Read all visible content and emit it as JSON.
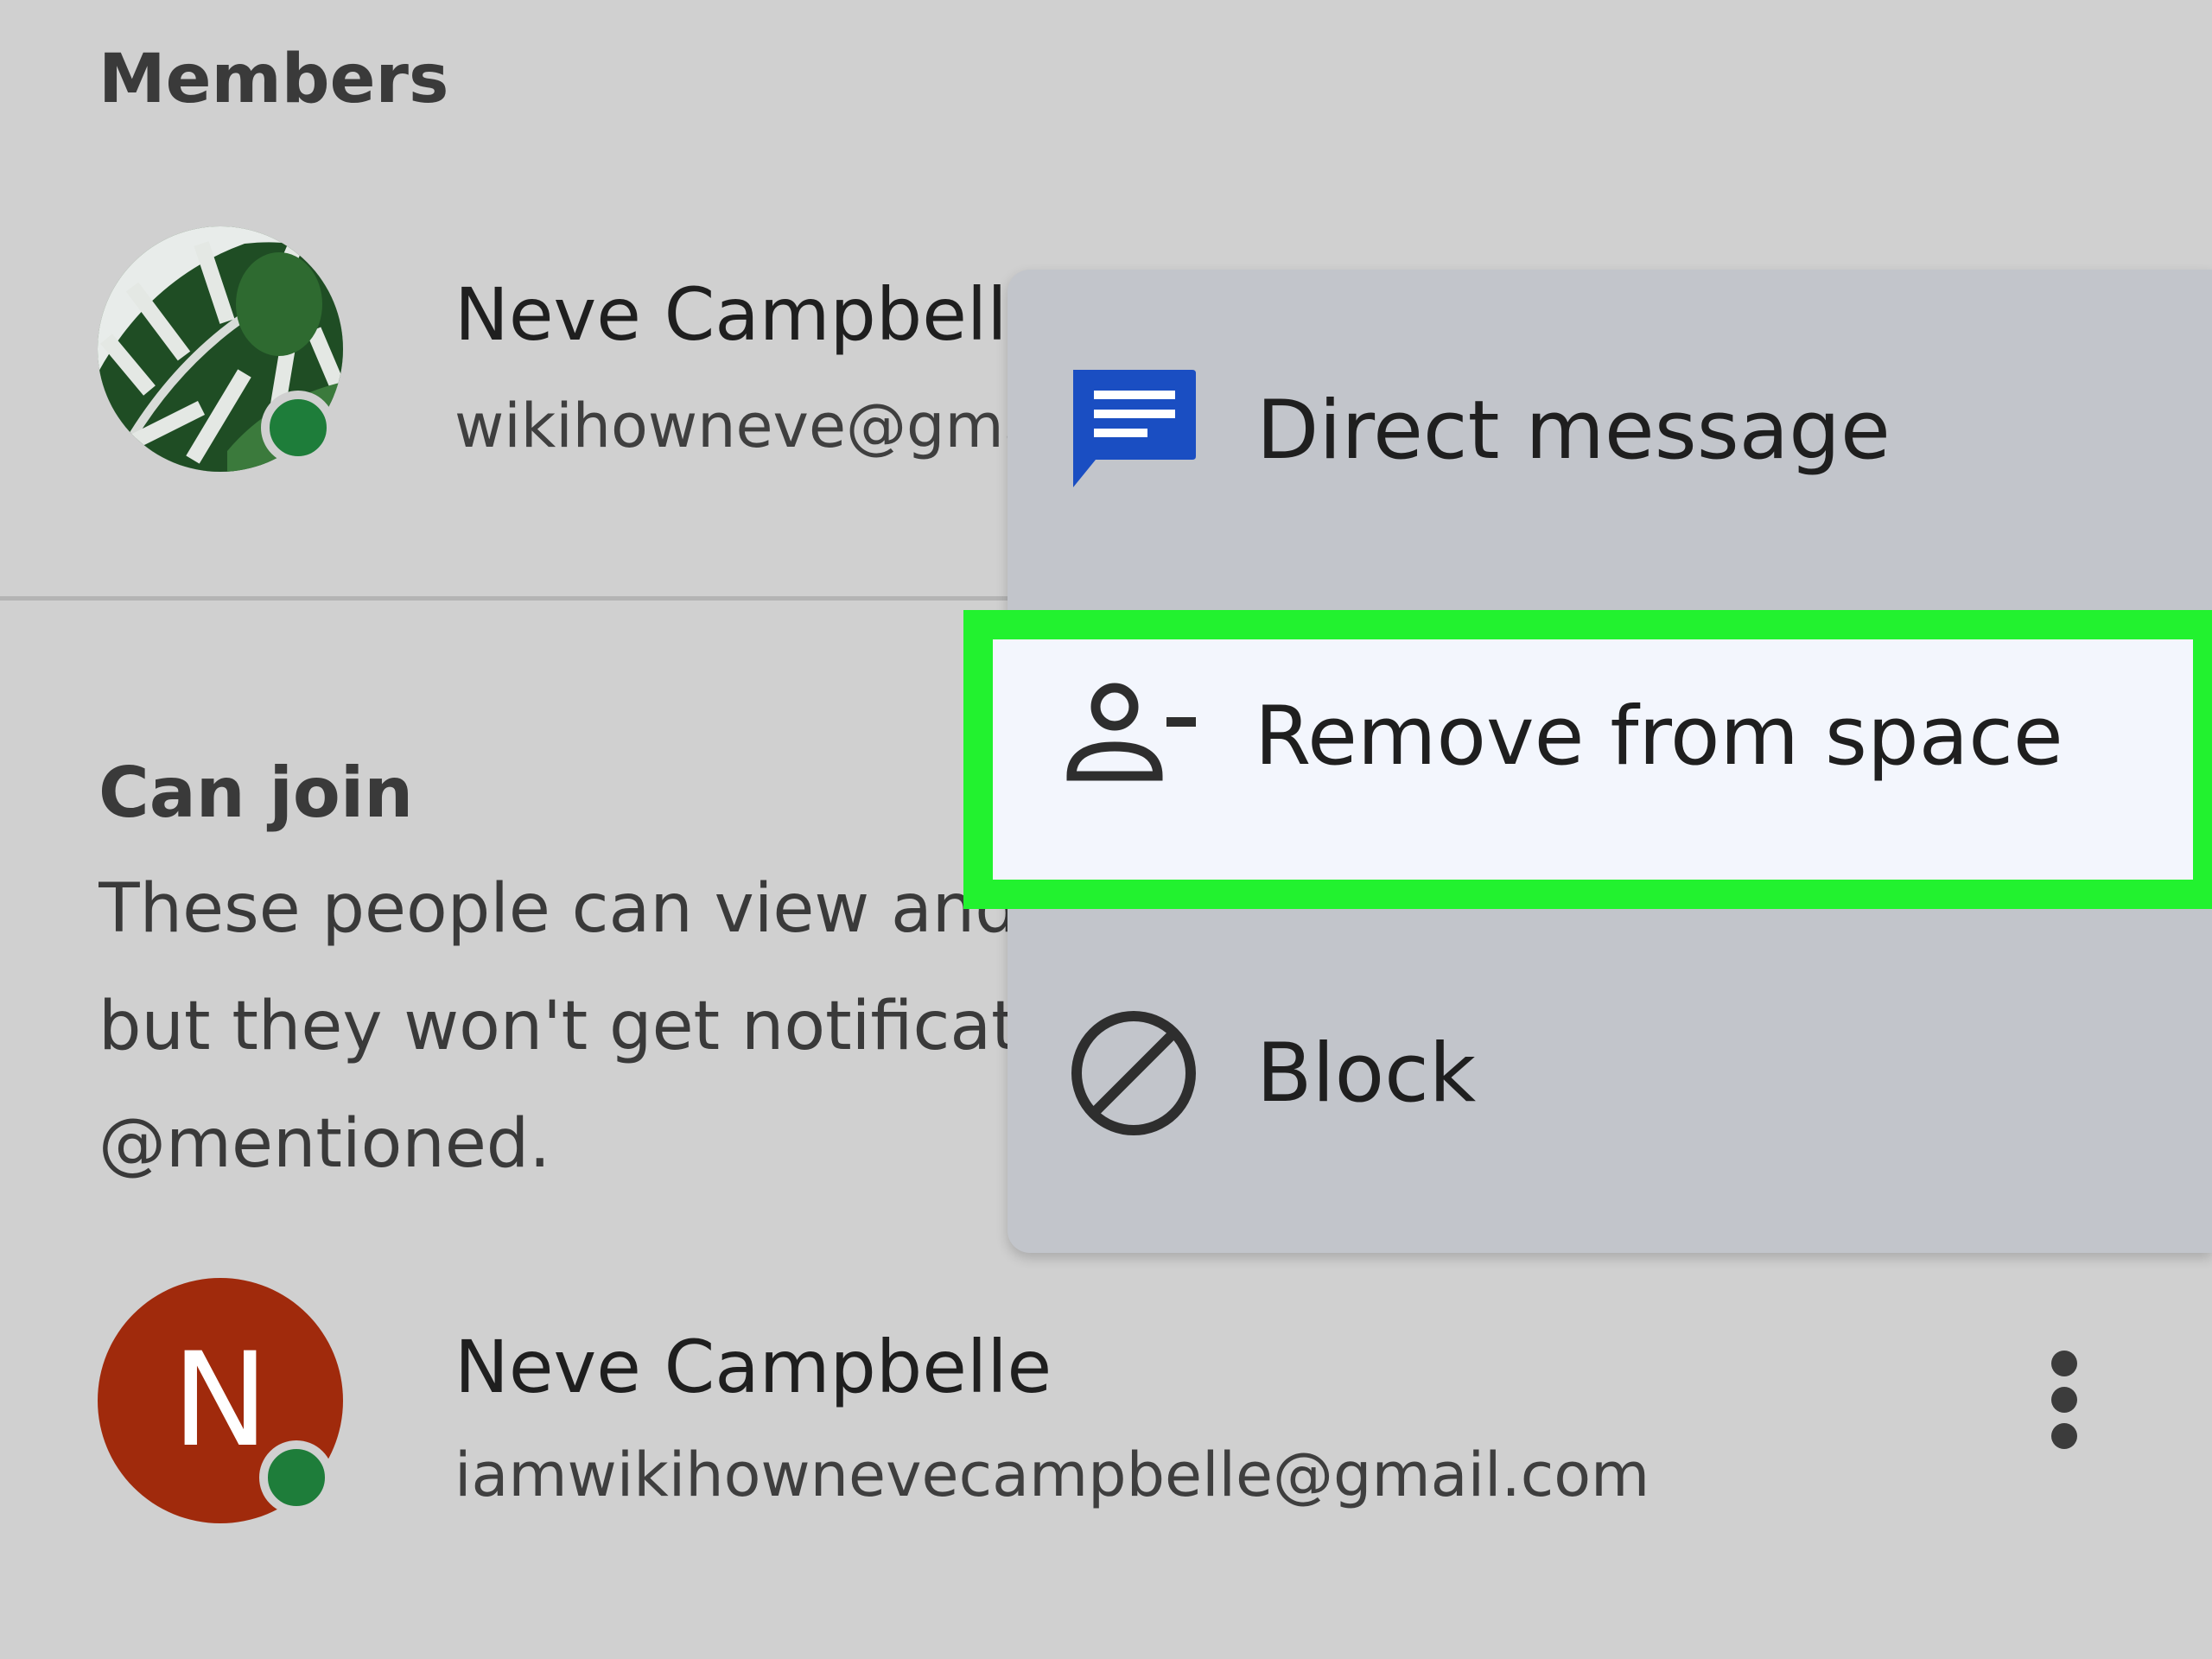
{
  "header": {
    "section_title": "Members"
  },
  "members": [
    {
      "name": "Neve Campbelle",
      "email": "wikihowneve@gmai",
      "avatar": "monstera-leaf-photo",
      "status": "online"
    },
    {
      "name": "Neve Campbelle",
      "email": "iamwikihownevecampbelle@gmail.com",
      "avatar_initial": "N",
      "status": "online"
    }
  ],
  "can_join": {
    "title": "Can join",
    "description_lines": [
      "These people can view and",
      "but they won't get notificati",
      "@mentioned."
    ]
  },
  "context_menu": {
    "items": [
      {
        "label": "Direct message",
        "icon": "chat-message-icon"
      },
      {
        "label": "Remove from space",
        "icon": "person-remove-icon",
        "highlighted": true
      },
      {
        "label": "Block",
        "icon": "block-icon"
      }
    ]
  },
  "colors": {
    "background": "#d0d0d0",
    "menu_background": "#c2c5cb",
    "highlight_outline": "#22f22f",
    "highlight_fill": "#f3f6fd",
    "message_icon": "#1a4ec2",
    "avatar_initial_bg": "#a02a0c",
    "online_status": "#1e7d3a"
  }
}
